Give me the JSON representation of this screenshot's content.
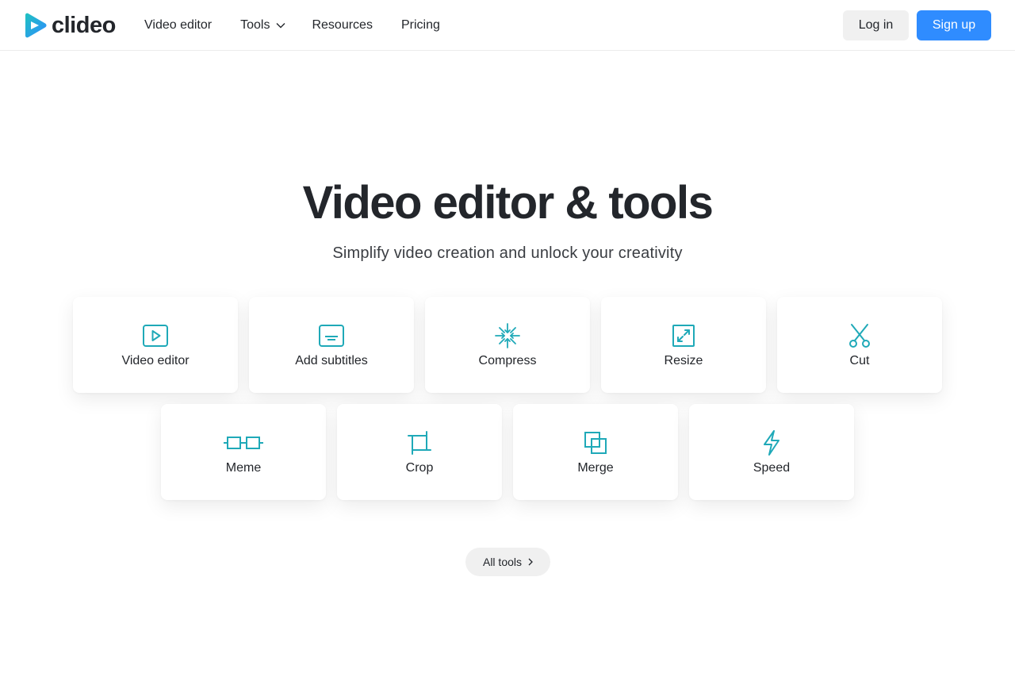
{
  "brand": {
    "name": "clideo",
    "accent": "#2f8cff",
    "icon_color": "#1fa9b8"
  },
  "header": {
    "nav": [
      {
        "label": "Video editor"
      },
      {
        "label": "Tools",
        "has_dropdown": true
      },
      {
        "label": "Resources"
      },
      {
        "label": "Pricing"
      }
    ],
    "login_label": "Log in",
    "signup_label": "Sign up"
  },
  "hero": {
    "title": "Video editor & tools",
    "subtitle": "Simplify video creation and unlock your creativity"
  },
  "tools": [
    {
      "label": "Video editor",
      "icon": "play-icon"
    },
    {
      "label": "Add subtitles",
      "icon": "subtitles-icon"
    },
    {
      "label": "Compress",
      "icon": "compress-icon"
    },
    {
      "label": "Resize",
      "icon": "resize-icon"
    },
    {
      "label": "Cut",
      "icon": "scissors-icon"
    },
    {
      "label": "Meme",
      "icon": "meme-icon"
    },
    {
      "label": "Crop",
      "icon": "crop-icon"
    },
    {
      "label": "Merge",
      "icon": "merge-icon"
    },
    {
      "label": "Speed",
      "icon": "lightning-icon"
    }
  ],
  "all_tools_label": "All tools"
}
